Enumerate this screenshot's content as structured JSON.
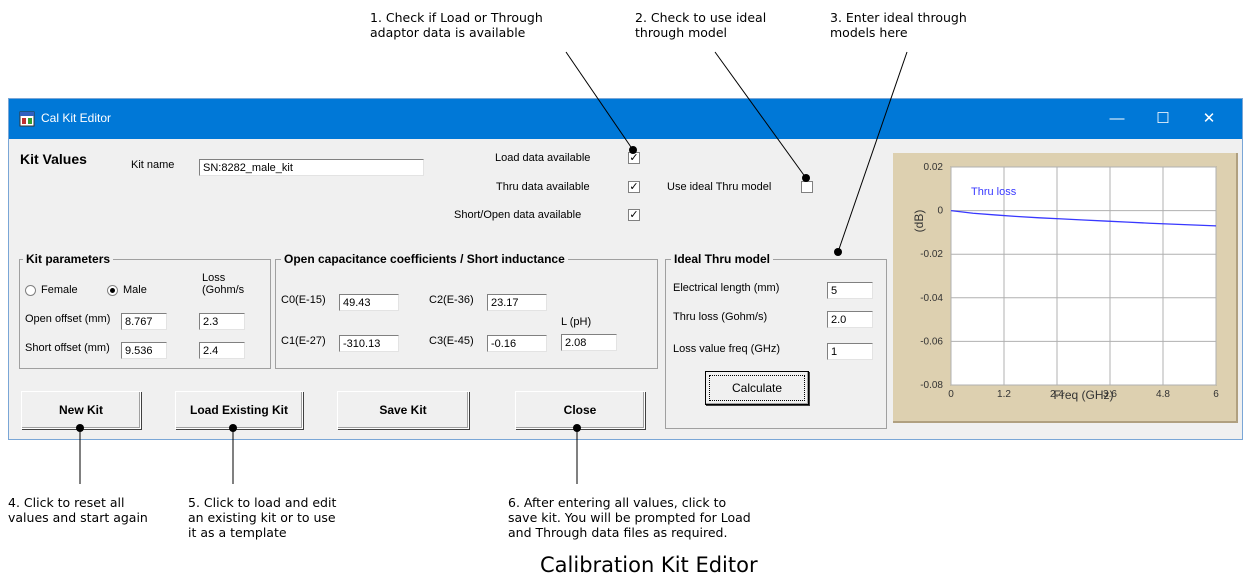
{
  "callouts": [
    {
      "text": "1. Check if Load or Through\nadaptor data is available"
    },
    {
      "text": "2. Check to use ideal\nthrough model"
    },
    {
      "text": "3. Enter ideal through\nmodels here"
    },
    {
      "text": "4. Click to reset all\nvalues and start again"
    },
    {
      "text": "5. Click to load and edit\nan existing kit or to use\nit as a template"
    },
    {
      "text": "6. After entering all values, click to\nsave kit. You will be prompted for Load\nand Through data files as required."
    }
  ],
  "caption": "Calibration Kit Editor",
  "window": {
    "title": "Cal Kit Editor",
    "minimize": "—",
    "maximize": "☐",
    "close": "✕"
  },
  "kit": {
    "heading": "Kit Values",
    "name_label": "Kit name",
    "name_value": "SN:8282_male_kit"
  },
  "availability": {
    "load_label": "Load data available",
    "load_checked": "✓",
    "thru_label": "Thru data available",
    "thru_checked": "✓",
    "short_label": "Short/Open data available",
    "short_checked": "✓",
    "ideal_label": "Use ideal Thru model",
    "ideal_checked": ""
  },
  "kit_params": {
    "title": "Kit parameters",
    "female": "Female",
    "male": "Male",
    "loss_label": "Loss\n(Gohm/s",
    "open_label": "Open offset (mm)",
    "open_value": "8.767",
    "open_loss": "2.3",
    "short_label": "Short offset (mm)",
    "short_value": "9.536",
    "short_loss": "2.4"
  },
  "coeffs": {
    "title": "Open capacitance coefficients / Short inductance",
    "c0_label": "C0(E-15)",
    "c0_value": "49.43",
    "c1_label": "C1(E-27)",
    "c1_value": "-310.13",
    "c2_label": "C2(E-36)",
    "c2_value": "23.17",
    "c3_label": "C3(E-45)",
    "c3_value": "-0.16",
    "l_label": "L (pH)",
    "l_value": "2.08"
  },
  "ideal_thru": {
    "title": "Ideal Thru model",
    "elec_label": "Electrical length (mm)",
    "elec_value": "5",
    "loss_label": "Thru loss (Gohm/s)",
    "loss_value": "2.0",
    "freq_label": "Loss value freq (GHz)",
    "freq_value": "1",
    "calc_button": "Calculate"
  },
  "buttons": {
    "new_kit": "New Kit",
    "load_kit": "Load Existing Kit",
    "save_kit": "Save Kit",
    "close": "Close"
  },
  "chart_data": {
    "type": "line",
    "title": "",
    "xlabel": "Freq (GHz)",
    "ylabel": "(dB)",
    "xlim": [
      0,
      6
    ],
    "ylim": [
      -0.08,
      0.02
    ],
    "x_ticks": [
      0,
      1.2,
      2.4,
      3.6,
      4.8,
      6
    ],
    "x_tick_labels": [
      "0",
      "1.2",
      "2.4",
      "3.6",
      "4.8",
      "6"
    ],
    "y_ticks": [
      0.02,
      0,
      -0.02,
      -0.04,
      -0.06,
      -0.08
    ],
    "y_tick_labels": [
      "0.02",
      "0",
      "-0.02",
      "-0.04",
      "-0.06",
      "-0.08"
    ],
    "grid": true,
    "series": [
      {
        "name": "Thru loss",
        "color": "#3838ff",
        "x": [
          0,
          0.5,
          1.0,
          1.5,
          2.0,
          2.5,
          3.0,
          3.5,
          4.0,
          4.5,
          5.0,
          5.5,
          6.0
        ],
        "y": [
          0,
          -0.0012,
          -0.002,
          -0.0027,
          -0.0033,
          -0.0038,
          -0.0043,
          -0.0048,
          -0.0053,
          -0.0058,
          -0.0062,
          -0.0066,
          -0.007
        ]
      }
    ]
  }
}
